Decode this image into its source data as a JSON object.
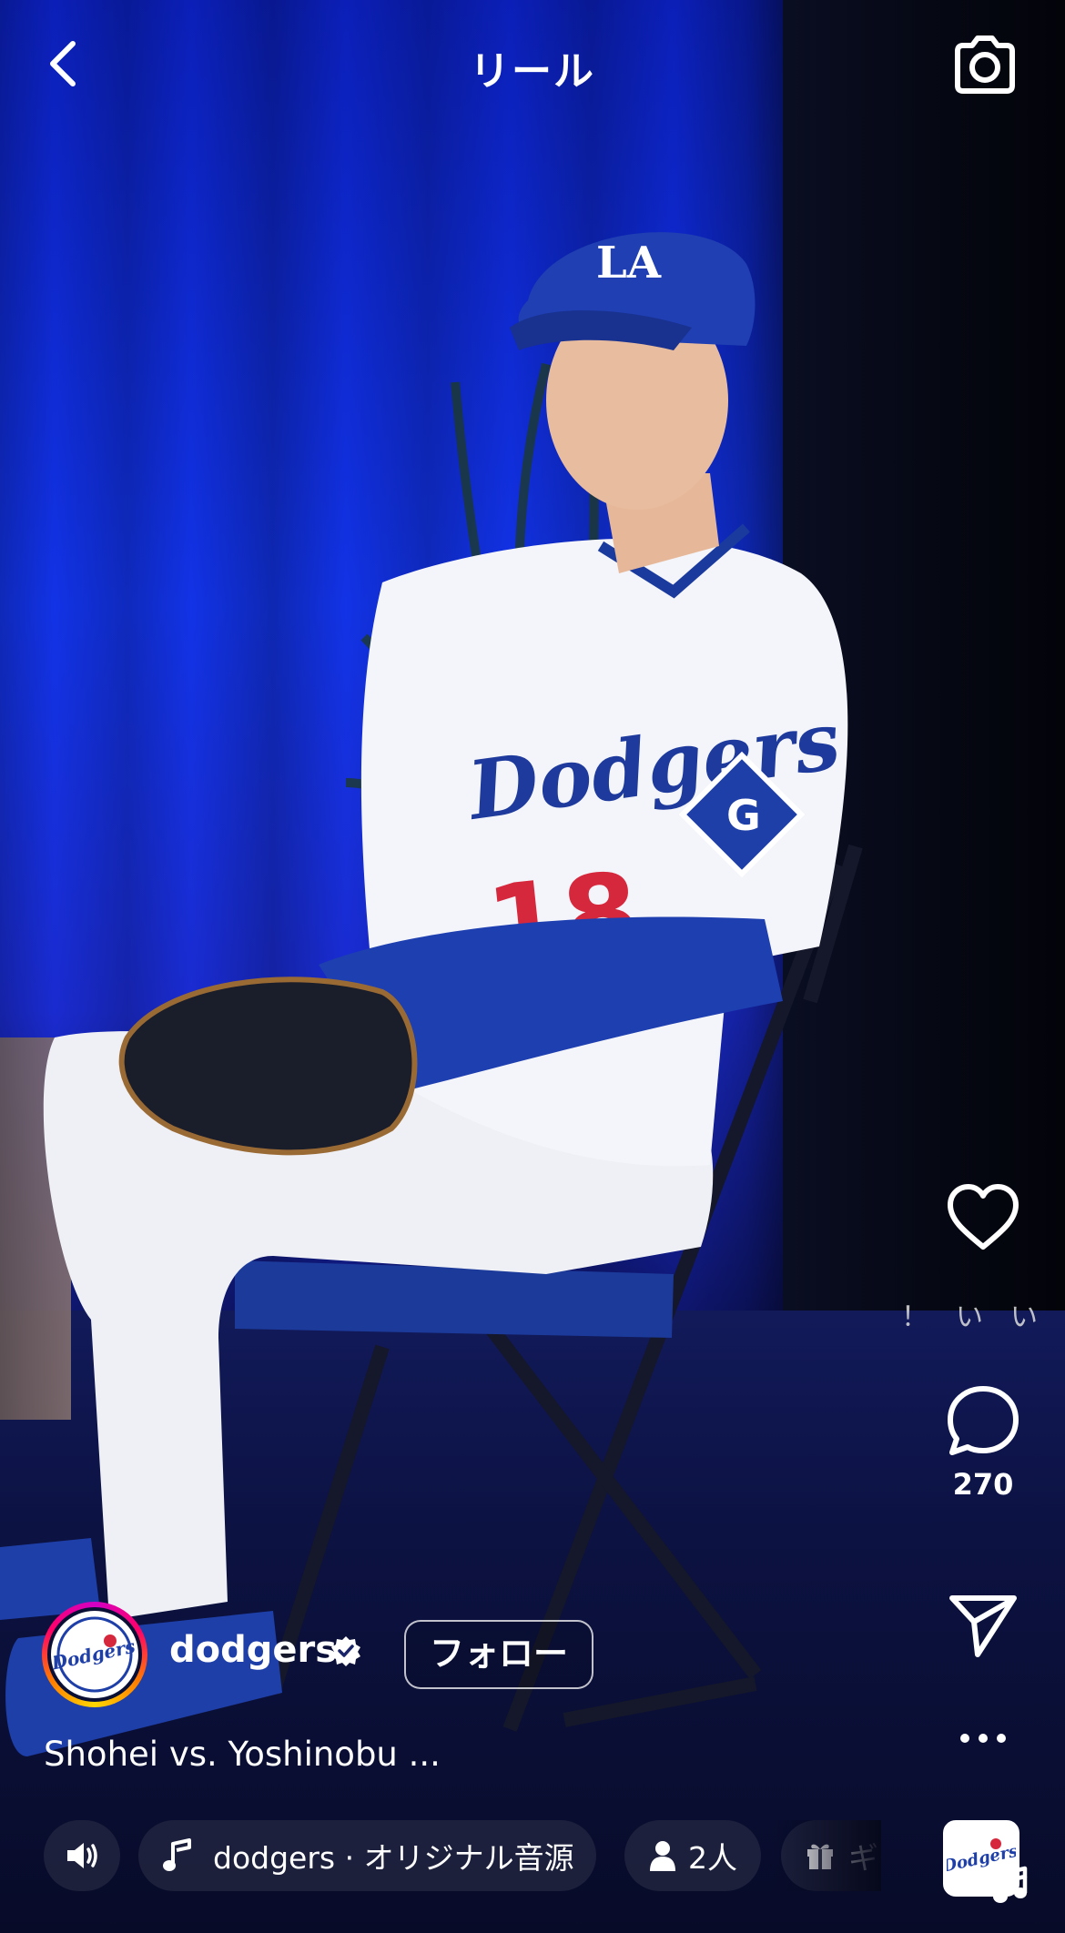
{
  "header": {
    "title": "リール",
    "back_icon": "chevron-left-icon",
    "camera_icon": "camera-icon"
  },
  "actions": {
    "like_label": "！いい",
    "comments_count": "270",
    "icons": [
      "heart-icon",
      "comment-icon",
      "send-icon",
      "more-icon"
    ]
  },
  "account": {
    "username": "dodgers",
    "verified": true,
    "follow_label": "フォロー",
    "avatar_logo_text": "Dodgers"
  },
  "caption": {
    "text": "Shohei vs. Yoshinobu ..."
  },
  "bottom_bar": {
    "audio_label": "dodgers · オリジナル音源",
    "people_label": "2人",
    "gift_label": "ギ"
  },
  "video": {
    "jersey_text": "Dodgers",
    "jersey_number": "18",
    "patch_letter": "G",
    "cap_logo": "LA"
  },
  "colors": {
    "background_blue": "#1233e6",
    "jersey_number": "#d6283c",
    "accent": "#ffffff"
  }
}
